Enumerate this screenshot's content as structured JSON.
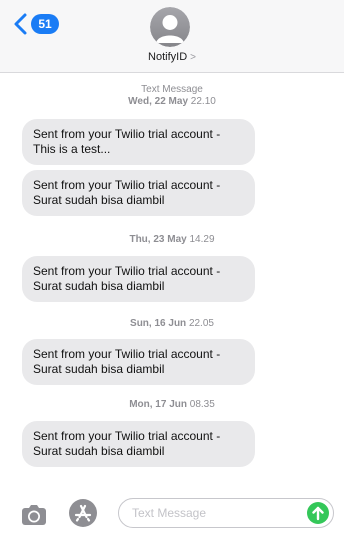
{
  "header": {
    "back_badge": "51",
    "contact_name": "NotifyID",
    "contact_chevron": ">"
  },
  "thread": {
    "items": [
      {
        "kind": "meta",
        "label": "Text Message",
        "day": "Wed, 22 May",
        "time": "22.10"
      },
      {
        "kind": "bubble",
        "line1": "Sent from your Twilio trial account -",
        "line2": "This is a test..."
      },
      {
        "kind": "bubble",
        "line1": "Sent from your Twilio trial account -",
        "line2": "Surat sudah bisa diambil"
      },
      {
        "kind": "meta",
        "day": "Thu, 23 May",
        "time": "14.29"
      },
      {
        "kind": "bubble",
        "line1": "Sent from your Twilio trial account -",
        "line2": "Surat sudah bisa diambil"
      },
      {
        "kind": "meta",
        "day": "Sun, 16 Jun",
        "time": "22.05"
      },
      {
        "kind": "bubble",
        "line1": "Sent from your Twilio trial account -",
        "line2": "Surat sudah bisa diambil"
      },
      {
        "kind": "meta",
        "day": "Mon, 17 Jun",
        "time": "08.35"
      },
      {
        "kind": "bubble",
        "line1": "Sent from your Twilio trial account -",
        "line2": "Surat sudah bisa diambil"
      }
    ]
  },
  "inputbar": {
    "placeholder": "Text Message",
    "camera_icon": "camera-icon",
    "apps_icon": "app-store-icon",
    "send_icon": "send-arrow-icon"
  },
  "colors": {
    "accent": "#1a7cf5",
    "bubble": "#e9e9eb",
    "send": "#34c759",
    "meta_text": "#8e8e93"
  }
}
